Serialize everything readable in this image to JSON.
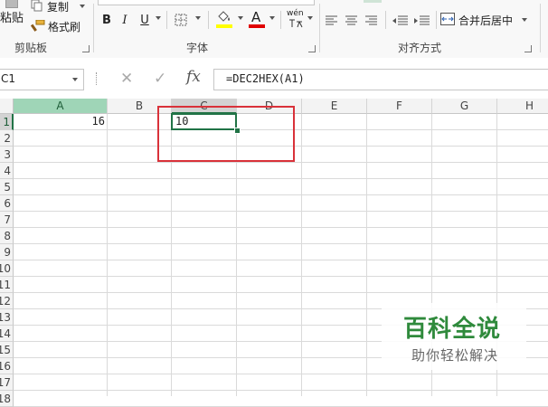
{
  "ribbon": {
    "clipboard": {
      "paste": "粘贴",
      "copy": "复制",
      "format_painter": "格式刷",
      "group": "剪贴板"
    },
    "font": {
      "bold": "B",
      "italic": "I",
      "underline": "U",
      "font_color": "A",
      "phonetic": "wén",
      "group": "字体"
    },
    "alignment": {
      "merge_center": "合并后居中",
      "group": "对齐方式"
    }
  },
  "formula_bar": {
    "name_box": "C1",
    "cancel": "✕",
    "enter": "✓",
    "fx": "fx",
    "formula": "=DEC2HEX(A1)"
  },
  "grid": {
    "columns": [
      "A",
      "B",
      "C",
      "D",
      "E",
      "F",
      "G",
      "H"
    ],
    "rows": [
      "1",
      "2",
      "3",
      "4",
      "5",
      "6",
      "7",
      "8",
      "9",
      "10",
      "11",
      "12",
      "13",
      "14",
      "15",
      "16",
      "17",
      "18"
    ],
    "cells": {
      "A1": "16",
      "C1": "10"
    },
    "selected_cell": "C1"
  },
  "watermark": {
    "title": "百科全说",
    "subtitle": "助你轻松解决"
  },
  "colors": {
    "highlight_fill": "#ffff00",
    "font_color_bar": "#e00000",
    "annotation": "#d9323a",
    "selection": "#217346",
    "watermark": "#2f8a3c"
  }
}
